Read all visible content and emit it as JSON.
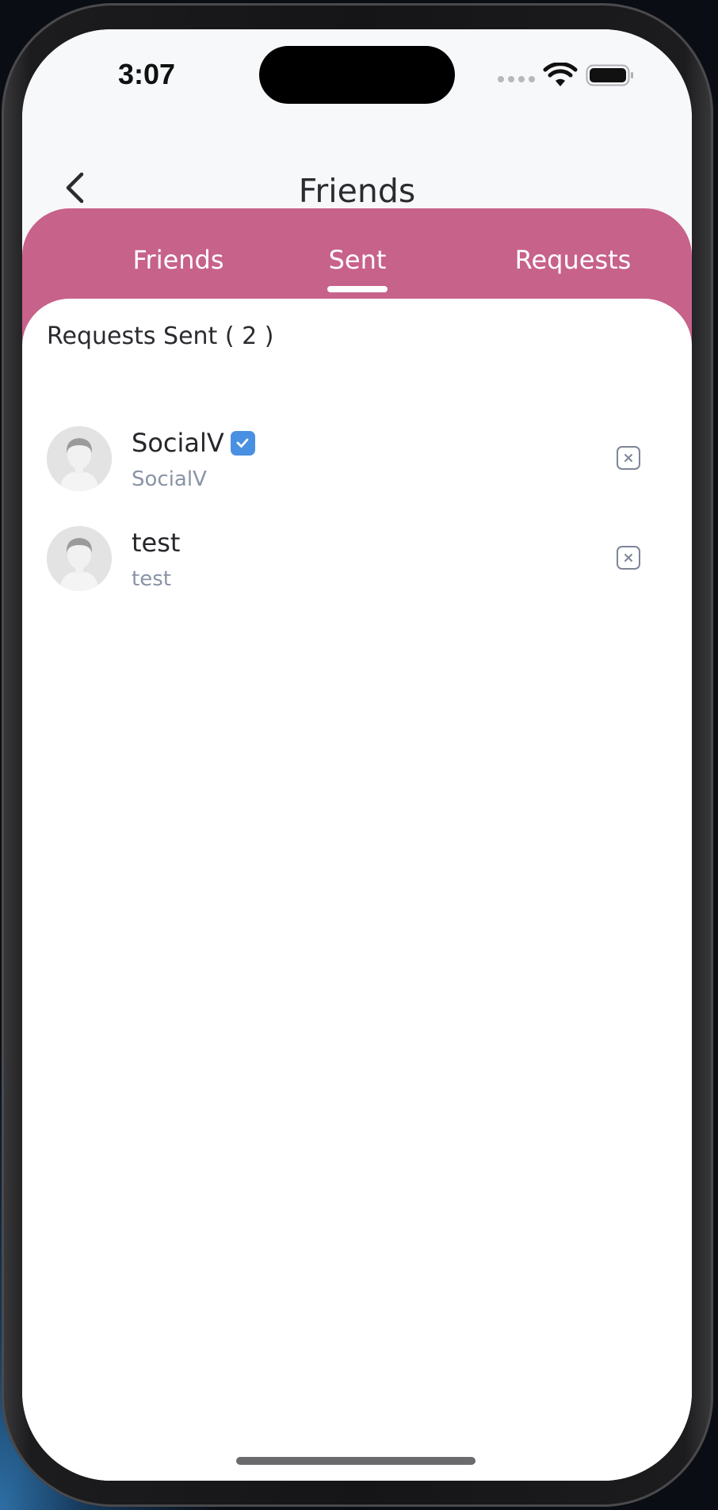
{
  "status_bar": {
    "time": "3:07"
  },
  "header": {
    "title": "Friends"
  },
  "tabs": [
    {
      "label": "Friends",
      "active": false
    },
    {
      "label": "Sent",
      "active": true
    },
    {
      "label": "Requests",
      "active": false
    }
  ],
  "section": {
    "title": "Requests Sent ( 2 )"
  },
  "requests": [
    {
      "name": "SocialV",
      "handle": "SocialV",
      "verified": true
    },
    {
      "name": "test",
      "handle": "test",
      "verified": false
    }
  ],
  "colors": {
    "accent": "#c7628b",
    "verified": "#4a90e2",
    "text_primary": "#26262b",
    "text_secondary": "#8a93a6"
  },
  "icons": {
    "back": "chevron-left-icon",
    "verified": "checkmark-badge-icon",
    "cancel": "close-square-icon",
    "avatar": "default-user-avatar"
  }
}
